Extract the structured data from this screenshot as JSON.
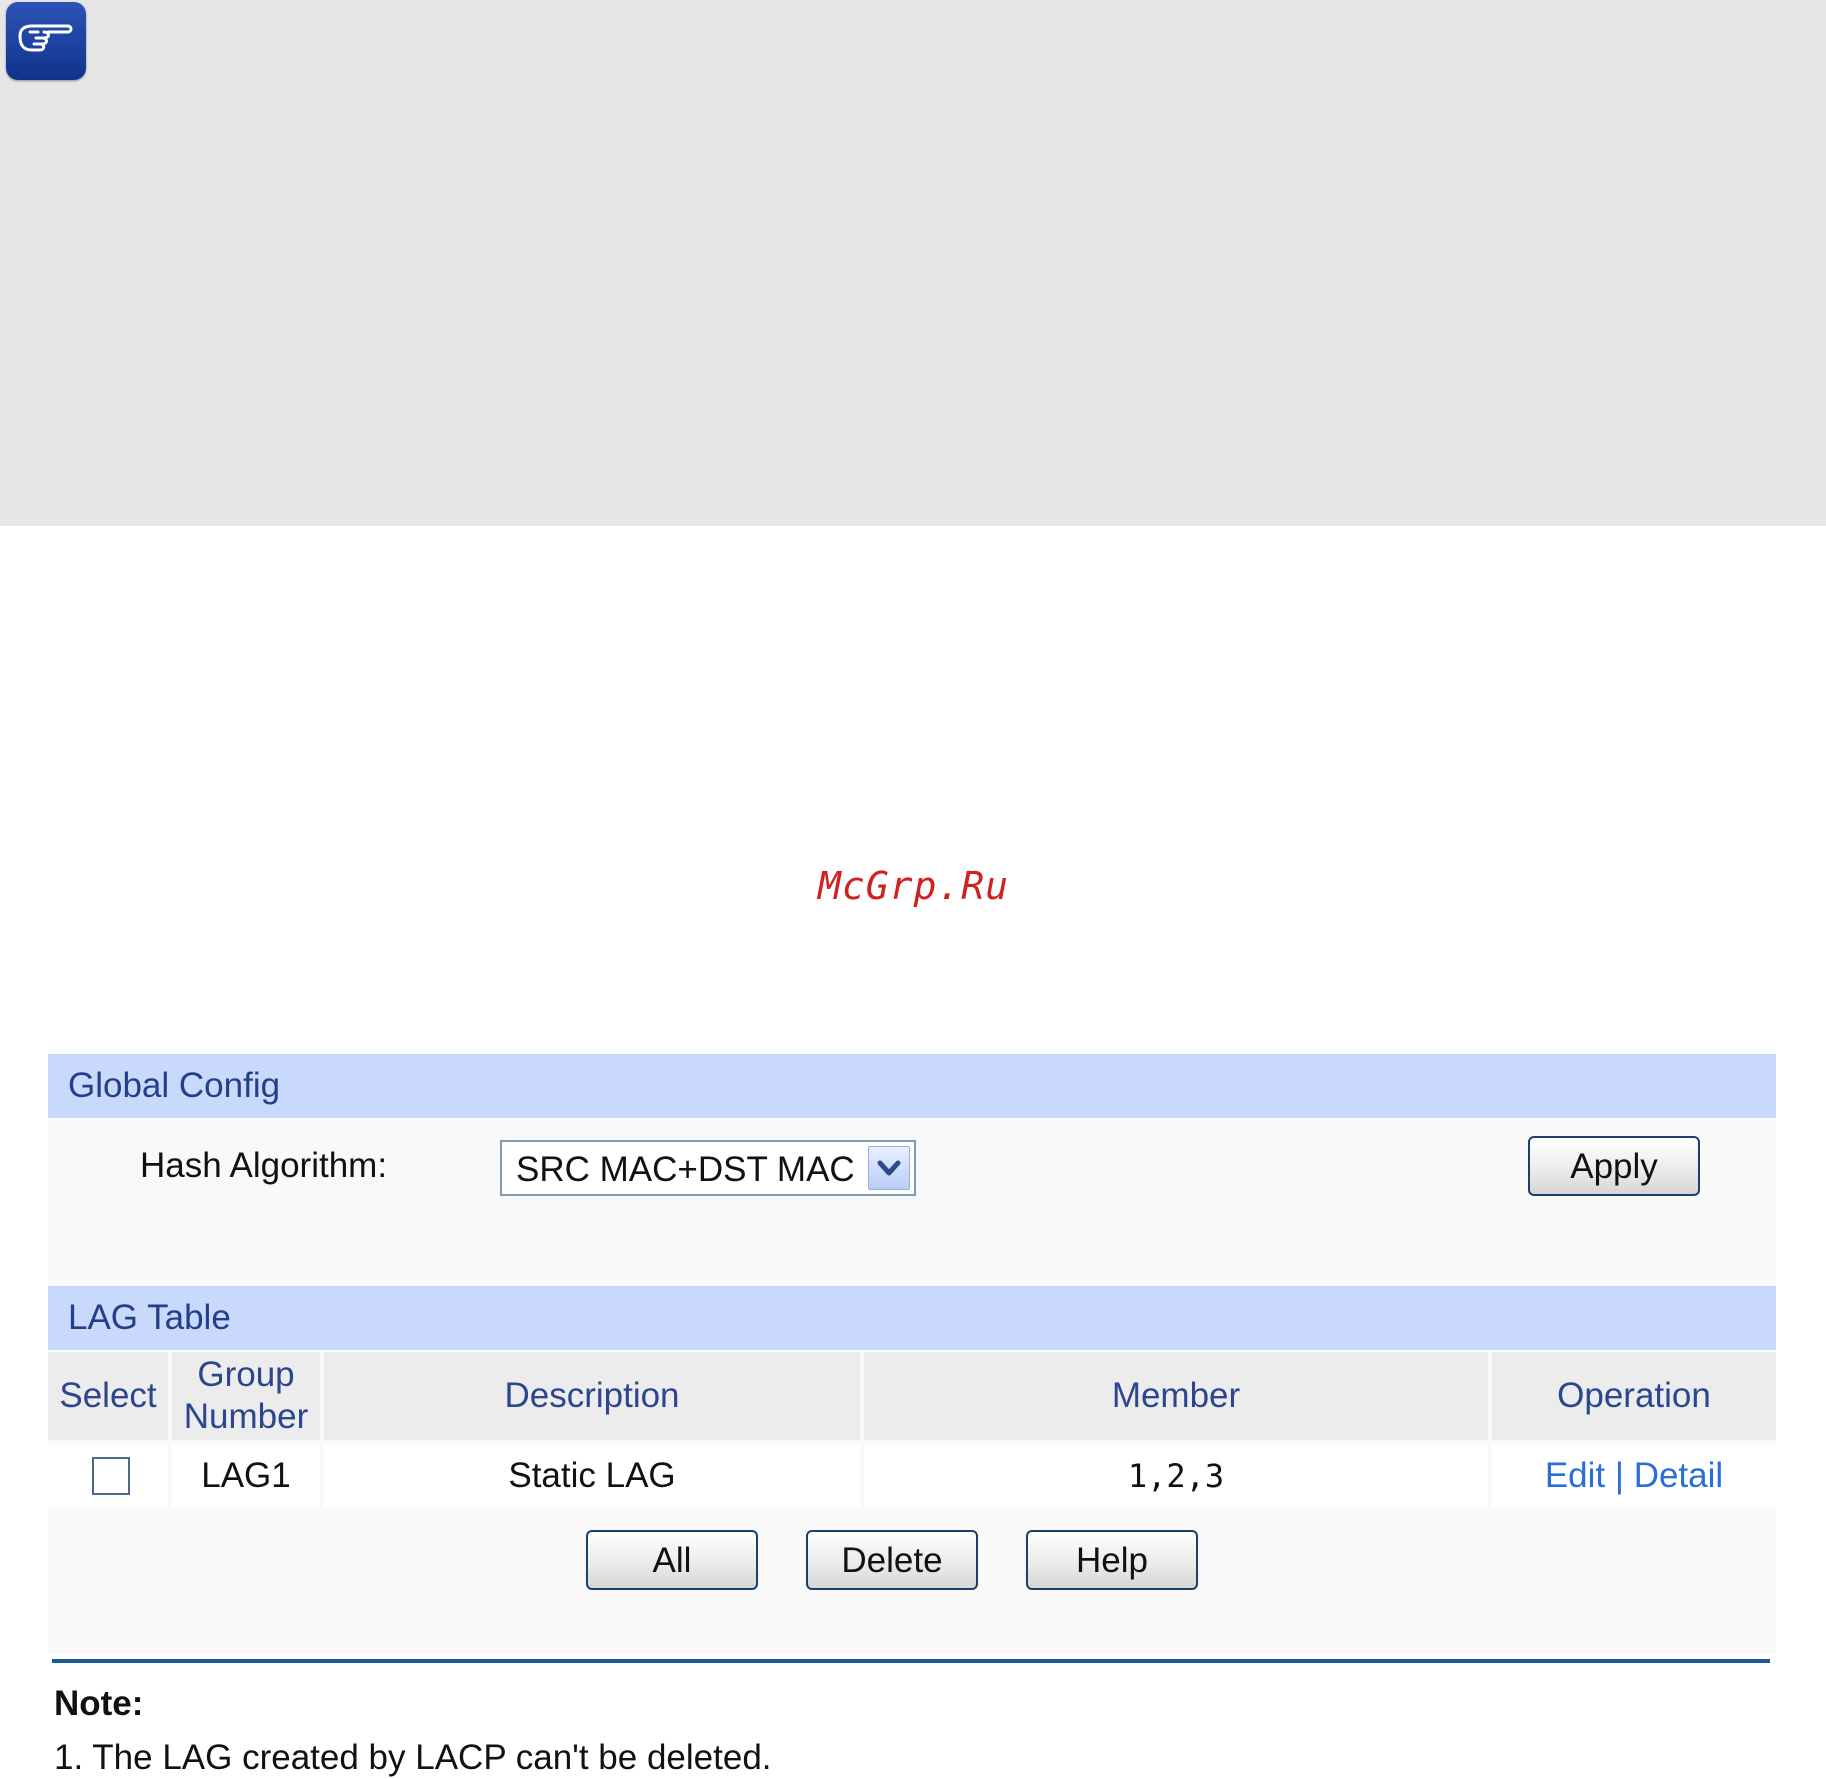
{
  "watermark": "McGrp.Ru",
  "global_config": {
    "title": "Global Config",
    "hash_label": "Hash Algorithm:",
    "hash_value": "SRC MAC+DST MAC",
    "apply_label": "Apply"
  },
  "lag_table": {
    "title": "LAG Table",
    "columns": {
      "select": "Select",
      "group_line1": "Group",
      "group_line2": "Number",
      "description": "Description",
      "member": "Member",
      "operation": "Operation"
    },
    "rows": [
      {
        "selected": false,
        "group": "LAG1",
        "description": "Static LAG",
        "member": "1,2,3",
        "edit": "Edit",
        "separator": "|",
        "detail": "Detail"
      }
    ],
    "buttons": {
      "all": "All",
      "delete": "Delete",
      "help": "Help"
    }
  },
  "note": {
    "title": "Note:",
    "lines": [
      "1. The LAG created by LACP can't be deleted."
    ]
  },
  "colors": {
    "header_bg": "#c8d9fb",
    "header_text": "#243f8a",
    "link": "#2a6fd6",
    "watermark": "#d21f1f",
    "rule": "#1f5a98"
  },
  "icons": {
    "note_icon": "pointing-hand-icon",
    "dropdown": "chevron-down-icon"
  }
}
